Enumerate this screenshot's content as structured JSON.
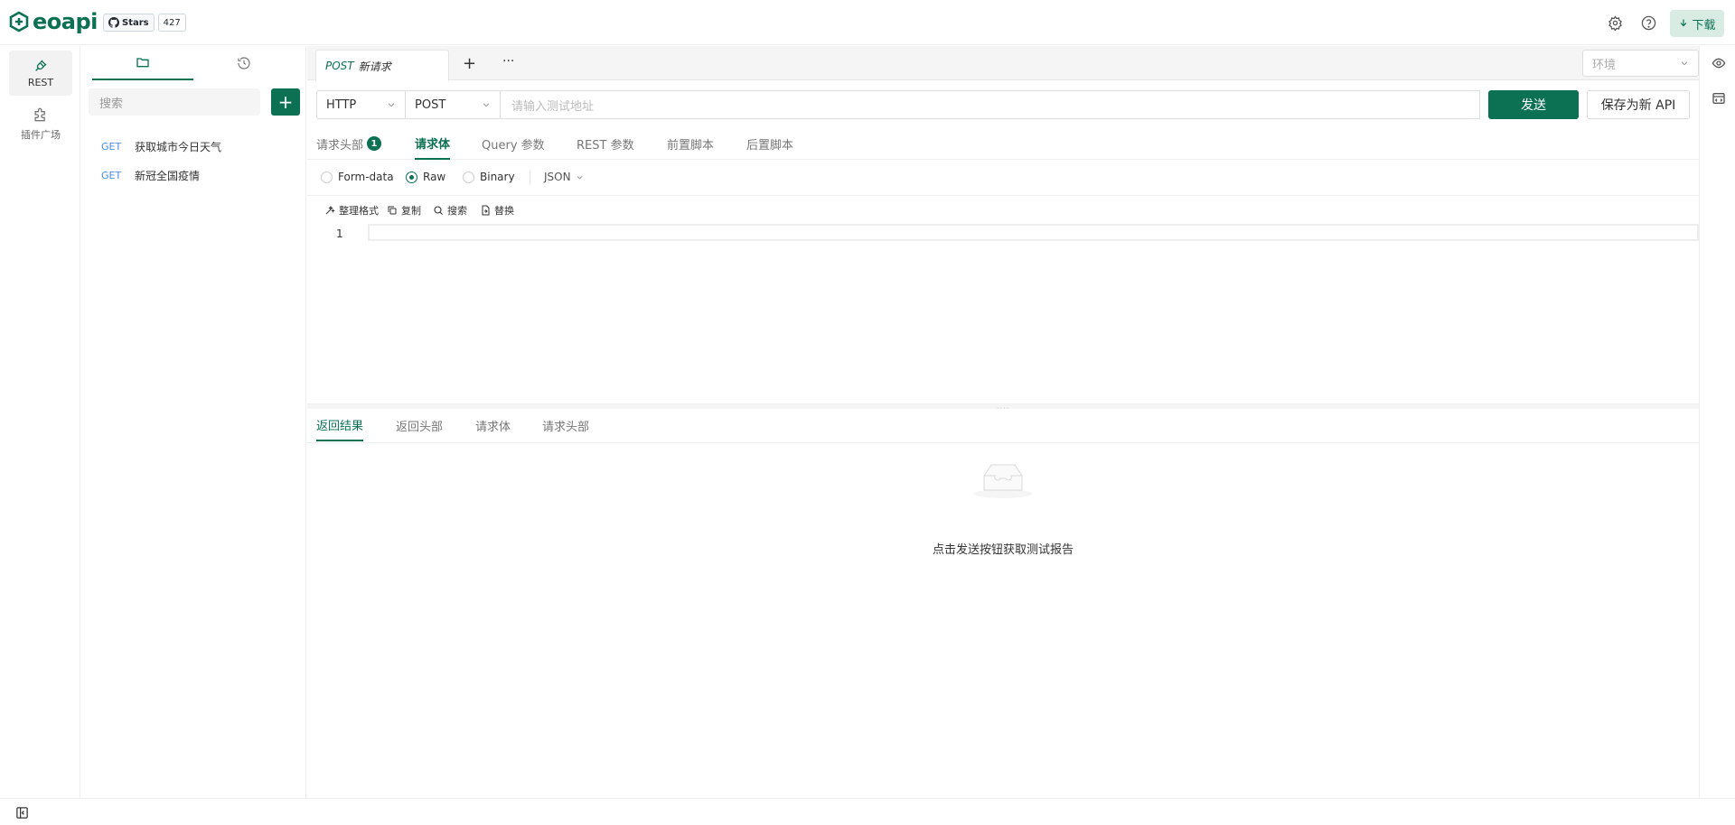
{
  "header": {
    "logo_text": "eoapi",
    "github_stars_label": "Stars",
    "github_stars_count": "427",
    "download_label": "下载",
    "brand_color": "#0b7152"
  },
  "rail": {
    "items": [
      {
        "label": "REST",
        "icon": "plug-icon"
      },
      {
        "label": "插件广场",
        "icon": "puzzle-icon"
      }
    ]
  },
  "sidebar": {
    "tabs": [
      {
        "icon": "folder-icon"
      },
      {
        "icon": "history-icon"
      }
    ],
    "search_placeholder": "搜索",
    "add_label": "+",
    "apis": [
      {
        "method": "GET",
        "name": "获取城市今日天气"
      },
      {
        "method": "GET",
        "name": "新冠全国疫情"
      }
    ]
  },
  "main": {
    "tab": {
      "method": "POST",
      "title": "新请求"
    },
    "tab_add": "+",
    "tab_more": "···",
    "env_placeholder": "环境",
    "protocol": "HTTP",
    "method": "POST",
    "url_placeholder": "请输入测试地址",
    "send_label": "发送",
    "save_label": "保存为新 API",
    "request_tabs": [
      {
        "label": "请求头部",
        "badge": "1"
      },
      {
        "label": "请求体"
      },
      {
        "label": "Query 参数"
      },
      {
        "label": "REST 参数"
      },
      {
        "label": "前置脚本"
      },
      {
        "label": "后置脚本"
      }
    ],
    "body_types": [
      "Form-data",
      "Raw",
      "Binary"
    ],
    "body_type_selected": "Raw",
    "format": "JSON",
    "editor_tools": [
      "整理格式",
      "复制",
      "搜索",
      "替换"
    ],
    "line_number": "1",
    "response_tabs": [
      "返回结果",
      "返回头部",
      "请求体",
      "请求头部"
    ],
    "empty_text": "点击发送按钮获取测试报告"
  }
}
